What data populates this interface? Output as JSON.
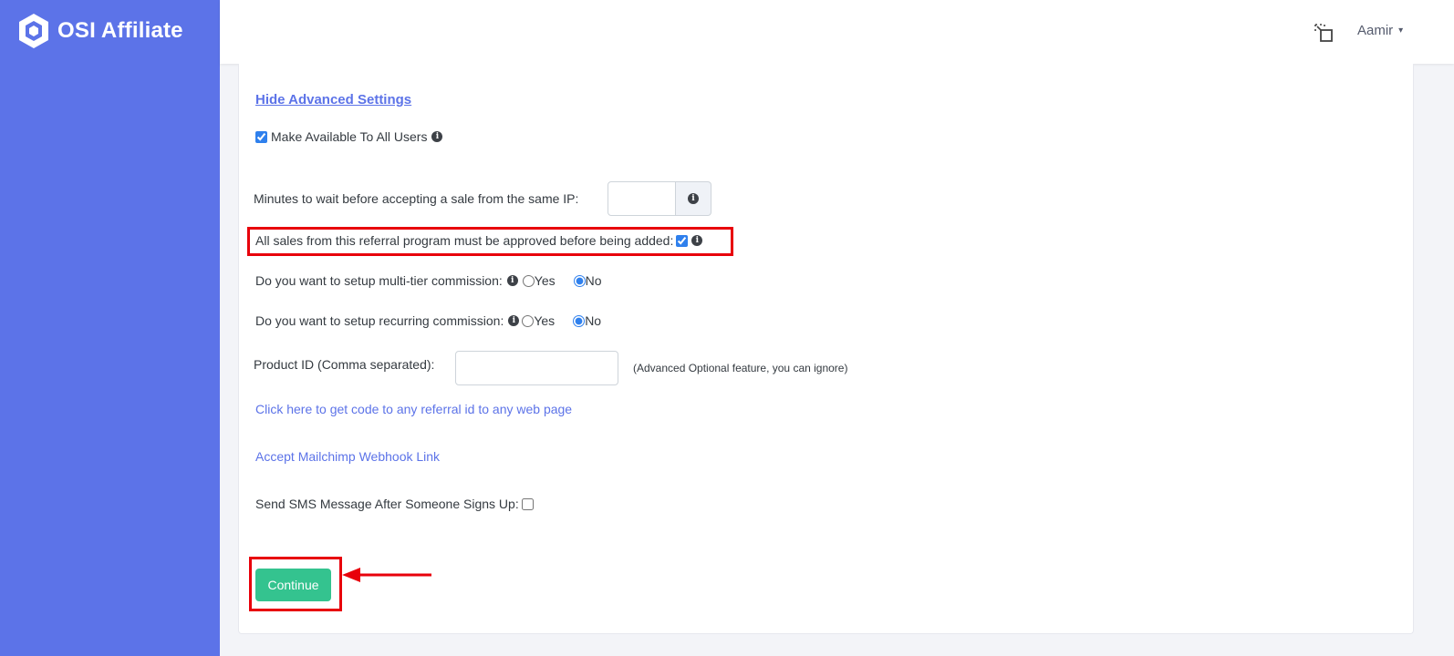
{
  "brand": {
    "name": "OSI Affiliate",
    "logo_icon": "hexagon-logo-icon"
  },
  "header": {
    "fullscreen_icon": "fullscreen-icon",
    "user_name": "Aamir",
    "user_chevron": "⌄"
  },
  "form": {
    "hide_advanced_link": "Hide Advanced Settings",
    "make_available": {
      "label": "Make Available To All Users",
      "checked": true
    },
    "wait_minutes": {
      "label": "Minutes to wait before accepting a sale from the same IP:",
      "value": ""
    },
    "approve_sales": {
      "label": "All sales from this referral program must be approved before being added:",
      "checked": true
    },
    "multi_tier": {
      "label": "Do you want to setup multi-tier commission:",
      "yes": "Yes",
      "no": "No",
      "selected": "No"
    },
    "recurring": {
      "label": "Do you want to setup recurring commission:",
      "yes": "Yes",
      "no": "No",
      "selected": "No"
    },
    "product_id": {
      "label": "Product ID (Comma separated):",
      "value": "",
      "hint": "(Advanced Optional feature, you can ignore)"
    },
    "code_link": "Click here to get code to any referral id to any web page",
    "mailchimp_link": "Accept Mailchimp Webhook Link",
    "sms": {
      "label": "Send SMS Message After Someone Signs Up:",
      "checked": false
    },
    "continue_label": "Continue"
  },
  "annotations": {
    "highlight_color": "#e8000b"
  },
  "colors": {
    "sidebar": "#5c73e8",
    "primary": "#5c73e8",
    "success": "#34c38f"
  }
}
